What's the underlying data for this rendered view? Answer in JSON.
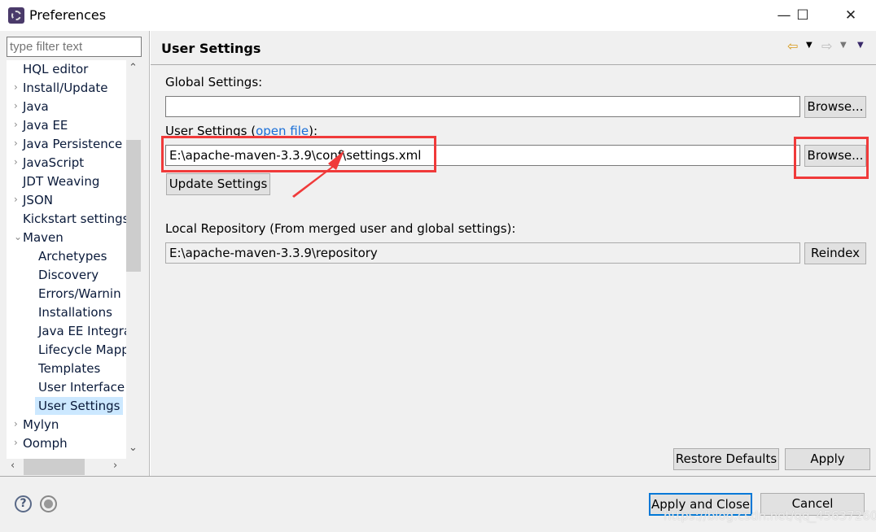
{
  "window": {
    "title": "Preferences",
    "minimize": "—",
    "maximize": "☐",
    "close": "✕"
  },
  "sidebar": {
    "filter_placeholder": "type filter text",
    "items": [
      {
        "label": "HQL editor",
        "level": 0,
        "chevron": ""
      },
      {
        "label": "Install/Update",
        "level": 0,
        "chevron": "›"
      },
      {
        "label": "Java",
        "level": 0,
        "chevron": "›"
      },
      {
        "label": "Java EE",
        "level": 0,
        "chevron": "›"
      },
      {
        "label": "Java Persistence",
        "level": 0,
        "chevron": "›"
      },
      {
        "label": "JavaScript",
        "level": 0,
        "chevron": "›"
      },
      {
        "label": "JDT Weaving",
        "level": 0,
        "chevron": ""
      },
      {
        "label": "JSON",
        "level": 0,
        "chevron": "›"
      },
      {
        "label": "Kickstart settings",
        "level": 0,
        "chevron": ""
      },
      {
        "label": "Maven",
        "level": 0,
        "chevron": "⌄"
      },
      {
        "label": "Archetypes",
        "level": 1,
        "chevron": ""
      },
      {
        "label": "Discovery",
        "level": 1,
        "chevron": ""
      },
      {
        "label": "Errors/Warnin",
        "level": 1,
        "chevron": ""
      },
      {
        "label": "Installations",
        "level": 1,
        "chevron": ""
      },
      {
        "label": "Java EE Integra",
        "level": 1,
        "chevron": ""
      },
      {
        "label": "Lifecycle Mapp",
        "level": 1,
        "chevron": ""
      },
      {
        "label": "Templates",
        "level": 1,
        "chevron": ""
      },
      {
        "label": "User Interface",
        "level": 1,
        "chevron": ""
      },
      {
        "label": "User Settings",
        "level": 1,
        "chevron": "",
        "selected": true
      },
      {
        "label": "Mylyn",
        "level": 0,
        "chevron": "›"
      },
      {
        "label": "Oomph",
        "level": 0,
        "chevron": "›"
      }
    ]
  },
  "main": {
    "title": "User Settings",
    "global_label": "Global Settings:",
    "global_value": "",
    "browse": "Browse...",
    "user_label_prefix": "User Settings (",
    "open_file": "open file",
    "user_label_suffix": "):",
    "user_value": "E:\\apache-maven-3.3.9\\conf\\settings.xml",
    "update_settings": "Update Settings",
    "local_label": "Local Repository (From merged user and global settings):",
    "local_value": "E:\\apache-maven-3.3.9\\repository",
    "reindex": "Reindex",
    "restore_defaults": "Restore Defaults",
    "apply": "Apply"
  },
  "footer": {
    "help": "?",
    "apply_close": "Apply and Close",
    "cancel": "Cancel"
  },
  "watermark": "https://blog.csdn.net/qq_45637260",
  "colors": {
    "annotation": "#f03a3a",
    "link": "#1a6fd8",
    "selection": "#cce8ff",
    "focus": "#0078d7"
  }
}
